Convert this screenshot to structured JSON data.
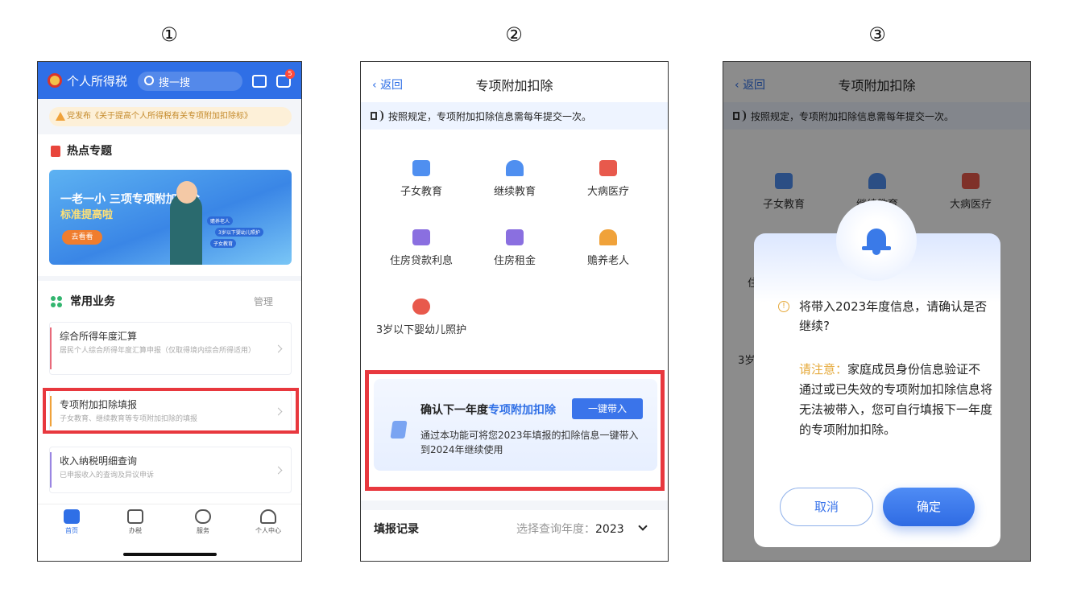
{
  "steps": [
    "①",
    "②",
    "③"
  ],
  "phone1": {
    "app_title": "个人所得税",
    "search_placeholder": "搜一搜",
    "message_badge": "5",
    "notice": "党发布《关于提高个人所得税有关专项附加扣除标》",
    "hot_title": "热点专题",
    "banner": {
      "line1": "一老一小 三项专项附加扣除",
      "line2": "标准提高啦",
      "button": "去看看",
      "tag1": "赡养老人",
      "tag2": "3岁以下婴幼儿照护",
      "tag3": "子女教育"
    },
    "common_title": "常用业务",
    "manage": "管理",
    "services": [
      {
        "title": "综合所得年度汇算",
        "desc": "居民个人综合所得年度汇算申报（仅取得境内综合所得适用）"
      },
      {
        "title": "专项附加扣除填报",
        "desc": "子女教育、继续教育等专项附加扣除的填报"
      },
      {
        "title": "收入纳税明细查询",
        "desc": "已申报收入的查询及异议申诉"
      }
    ],
    "tabs": [
      "首页",
      "办税",
      "服务",
      "个人中心"
    ]
  },
  "phone2": {
    "back": "返回",
    "title": "专项附加扣除",
    "notice": "按照规定，专项附加扣除信息需每年提交一次。",
    "items": [
      "子女教育",
      "继续教育",
      "大病医疗",
      "住房贷款利息",
      "住房租金",
      "赡养老人",
      "3岁以下婴幼儿照护"
    ],
    "confirm": {
      "title_prefix": "确认下一年度",
      "title_highlight": "专项附加扣除",
      "button": "一键带入",
      "desc": "通过本功能可将您2023年填报的扣除信息一键带入到2024年继续使用"
    },
    "record_title": "填报记录",
    "year_label": "选择查询年度：",
    "year_value": "2023"
  },
  "phone3": {
    "back": "返回",
    "title": "专项附加扣除",
    "notice": "按照规定，专项附加扣除信息需每年提交一次。",
    "visible_items": [
      "子女教育",
      "继续教育",
      "大病医疗"
    ],
    "partial_left_1": "住",
    "partial_left_2": "3岁",
    "message": "将带入2023年度信息，请确认是否继续?",
    "note_label": "请注意：",
    "note_text": "家庭成员身份信息验证不通过或已失效的专项附加扣除信息将无法被带入，您可自行填报下一年度的专项附加扣除。",
    "cancel": "取消",
    "confirm": "确定"
  },
  "colors": {
    "brand_blue": "#2f6fe6",
    "highlight_red": "#e8383e",
    "warning_orange": "#e5a93a"
  }
}
